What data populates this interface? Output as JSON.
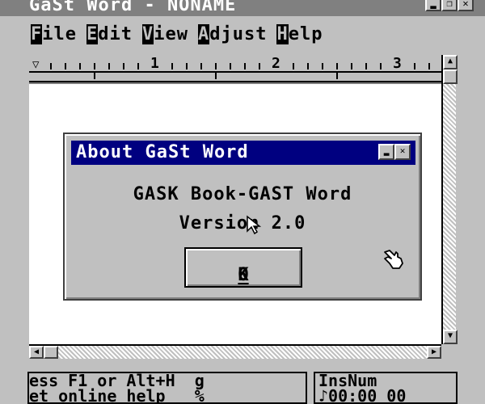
{
  "window": {
    "title": "GaSt Word - NONAME",
    "controls": [
      "minimize",
      "restore",
      "close"
    ]
  },
  "menubar": {
    "items": [
      {
        "accel": "F",
        "rest": "ile"
      },
      {
        "accel": "E",
        "rest": "dit"
      },
      {
        "accel": "V",
        "rest": "iew"
      },
      {
        "accel": "A",
        "rest": "djust"
      },
      {
        "accel": "H",
        "rest": "elp"
      }
    ]
  },
  "ruler": {
    "numbers": [
      "1",
      "2",
      "3"
    ]
  },
  "dialog": {
    "title": "About GaSt Word",
    "line1": "GASK Book-GAST Word",
    "line2": "Version 2.0",
    "ok_accel": "O",
    "ok_rest": "K"
  },
  "status": {
    "left_line1": "ess F1 or Alt+H  g",
    "left_line2": "et online help   %",
    "right_line1": "InsNum",
    "right_line2": "♪00:00 00"
  },
  "icons": {
    "cursor": "arrow-cursor-icon",
    "hand": "hand-cursor-icon"
  }
}
